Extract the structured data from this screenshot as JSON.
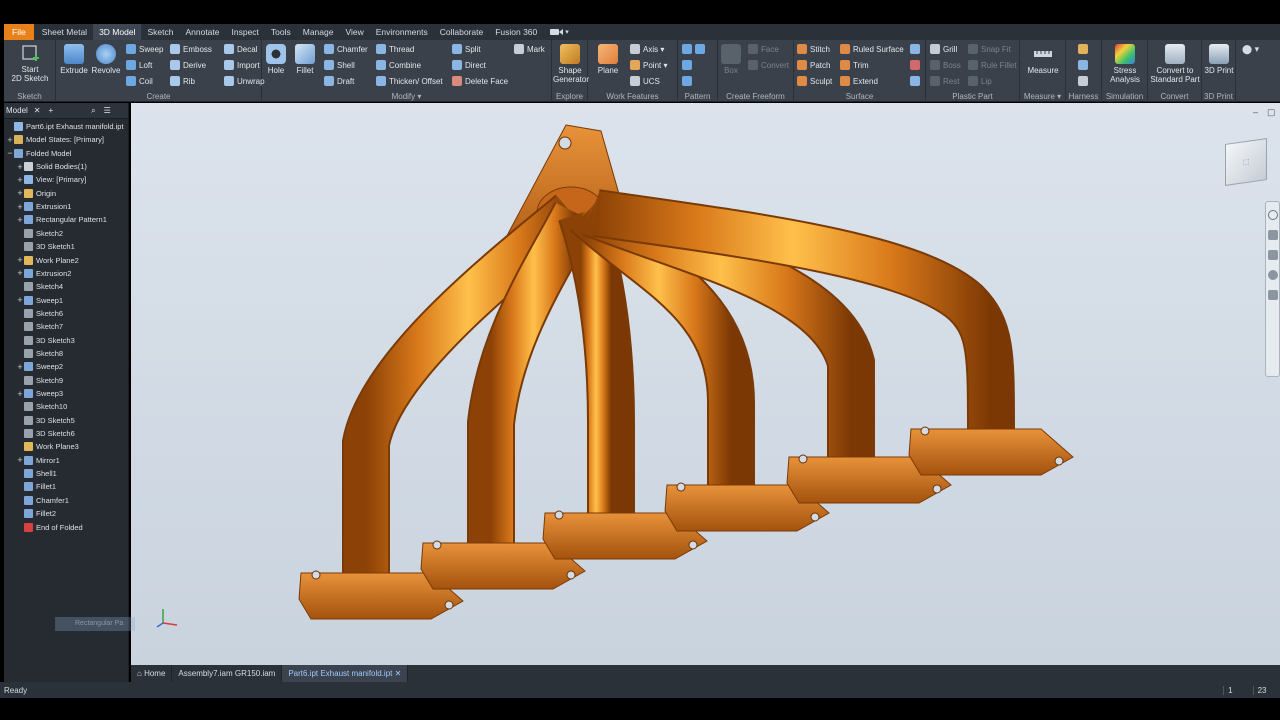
{
  "menubar": {
    "tabs": [
      "File",
      "Sheet Metal",
      "3D Model",
      "Sketch",
      "Annotate",
      "Inspect",
      "Tools",
      "Manage",
      "View",
      "Environments",
      "Collaborate",
      "Fusion 360"
    ],
    "active": "3D Model"
  },
  "ribbon": {
    "sketch": {
      "label": "Sketch",
      "start_line1": "Start",
      "start_line2": "2D Sketch"
    },
    "create": {
      "label": "Create",
      "extrude": "Extrude",
      "revolve": "Revolve",
      "sweep": "Sweep",
      "loft": "Loft",
      "coil": "Coil",
      "emboss": "Emboss",
      "derive": "Derive",
      "rib": "Rib",
      "decal": "Decal",
      "import": "Import",
      "unwrap": "Unwrap"
    },
    "modify": {
      "label": "Modify",
      "hole": "Hole",
      "fillet": "Fillet",
      "chamfer": "Chamfer",
      "shell": "Shell",
      "draft": "Draft",
      "thread": "Thread",
      "combine": "Combine",
      "thicken": "Thicken/ Offset",
      "split": "Split",
      "direct": "Direct",
      "delete_face": "Delete Face",
      "mark": "Mark"
    },
    "explore": {
      "label": "Explore",
      "shape_line1": "Shape",
      "shape_line2": "Generator"
    },
    "work_features": {
      "label": "Work Features",
      "plane": "Plane",
      "axis": "Axis",
      "point": "Point",
      "ucs": "UCS"
    },
    "pattern": {
      "label": "Pattern"
    },
    "freeform": {
      "label": "Create Freeform",
      "box": "Box",
      "face": "Face",
      "convert": "Convert"
    },
    "surface": {
      "label": "Surface",
      "stitch": "Stitch",
      "patch": "Patch",
      "sculpt": "Sculpt",
      "ruled": "Ruled Surface",
      "trim": "Trim",
      "extend": "Extend"
    },
    "plastic": {
      "label": "Plastic Part",
      "grill": "Grill",
      "boss": "Boss",
      "rest": "Rest",
      "snap_fit": "Snap Fit",
      "rule_fillet": "Rule Fillet",
      "lip": "Lip"
    },
    "measure": {
      "label": "Measure",
      "measure": "Measure"
    },
    "harness": {
      "label": "Harness"
    },
    "simulation": {
      "label": "Simulation",
      "line1": "Stress",
      "line2": "Analysis"
    },
    "convert": {
      "label": "Convert",
      "line1": "Convert to",
      "line2": "Standard Part"
    },
    "print": {
      "label": "3D Print",
      "btn": "3D Print"
    }
  },
  "browser": {
    "title": "Model",
    "items": [
      {
        "label": "Part6.ipt Exhaust manifold.ipt",
        "indent": 0,
        "expander": "",
        "color": "#8fb6e6"
      },
      {
        "label": "Model States: [Primary]",
        "indent": 0,
        "expander": "+",
        "color": "#d9b25a"
      },
      {
        "label": "Folded Model",
        "indent": 0,
        "expander": "−",
        "color": "#7fa7d6"
      },
      {
        "label": "Solid Bodies(1)",
        "indent": 1,
        "expander": "+",
        "color": "#c9cfd6"
      },
      {
        "label": "View: [Primary]",
        "indent": 1,
        "expander": "+",
        "color": "#8fb6e6"
      },
      {
        "label": "Origin",
        "indent": 1,
        "expander": "+",
        "color": "#e0b85a"
      },
      {
        "label": "Extrusion1",
        "indent": 1,
        "expander": "+",
        "color": "#7ea6d8"
      },
      {
        "label": "Rectangular Pattern1",
        "indent": 1,
        "expander": "+",
        "color": "#7ea6d8"
      },
      {
        "label": "Sketch2",
        "indent": 1,
        "expander": "",
        "color": "#9aa3ad"
      },
      {
        "label": "3D Sketch1",
        "indent": 1,
        "expander": "",
        "color": "#9aa3ad"
      },
      {
        "label": "Work Plane2",
        "indent": 1,
        "expander": "+",
        "color": "#e0b85a"
      },
      {
        "label": "Extrusion2",
        "indent": 1,
        "expander": "+",
        "color": "#7ea6d8"
      },
      {
        "label": "Sketch4",
        "indent": 1,
        "expander": "",
        "color": "#9aa3ad"
      },
      {
        "label": "Sweep1",
        "indent": 1,
        "expander": "+",
        "color": "#7ea6d8"
      },
      {
        "label": "Sketch6",
        "indent": 1,
        "expander": "",
        "color": "#9aa3ad"
      },
      {
        "label": "Sketch7",
        "indent": 1,
        "expander": "",
        "color": "#9aa3ad"
      },
      {
        "label": "3D Sketch3",
        "indent": 1,
        "expander": "",
        "color": "#9aa3ad"
      },
      {
        "label": "Sketch8",
        "indent": 1,
        "expander": "",
        "color": "#9aa3ad"
      },
      {
        "label": "Sweep2",
        "indent": 1,
        "expander": "+",
        "color": "#7ea6d8"
      },
      {
        "label": "Sketch9",
        "indent": 1,
        "expander": "",
        "color": "#9aa3ad"
      },
      {
        "label": "Sweep3",
        "indent": 1,
        "expander": "+",
        "color": "#7ea6d8"
      },
      {
        "label": "Sketch10",
        "indent": 1,
        "expander": "",
        "color": "#9aa3ad"
      },
      {
        "label": "3D Sketch5",
        "indent": 1,
        "expander": "",
        "color": "#9aa3ad"
      },
      {
        "label": "3D Sketch6",
        "indent": 1,
        "expander": "",
        "color": "#9aa3ad"
      },
      {
        "label": "Work Plane3",
        "indent": 1,
        "expander": "",
        "color": "#e0b85a"
      },
      {
        "label": "Mirror1",
        "indent": 1,
        "expander": "+",
        "color": "#7ea6d8"
      },
      {
        "label": "Shell1",
        "indent": 1,
        "expander": "",
        "color": "#7ea6d8"
      },
      {
        "label": "Fillet1",
        "indent": 1,
        "expander": "",
        "color": "#7ea6d8"
      },
      {
        "label": "Chamfer1",
        "indent": 1,
        "expander": "",
        "color": "#7ea6d8"
      },
      {
        "label": "Fillet2",
        "indent": 1,
        "expander": "",
        "color": "#7ea6d8"
      },
      {
        "label": "End of Folded",
        "indent": 1,
        "expander": "",
        "color": "#d94040"
      }
    ]
  },
  "viewport": {
    "hint": "Rectangular Pa"
  },
  "doctabs": {
    "home": "Home",
    "tab1": "Assembly7.iam GR150.iam",
    "tab2": "Part6.ipt Exhaust manifold.ipt"
  },
  "status": {
    "text": "Ready",
    "n1": "1",
    "n2": "23"
  },
  "colors": {
    "accent": "#e8811a",
    "part": "#d9741a",
    "viewport": "#d3dbe5"
  }
}
